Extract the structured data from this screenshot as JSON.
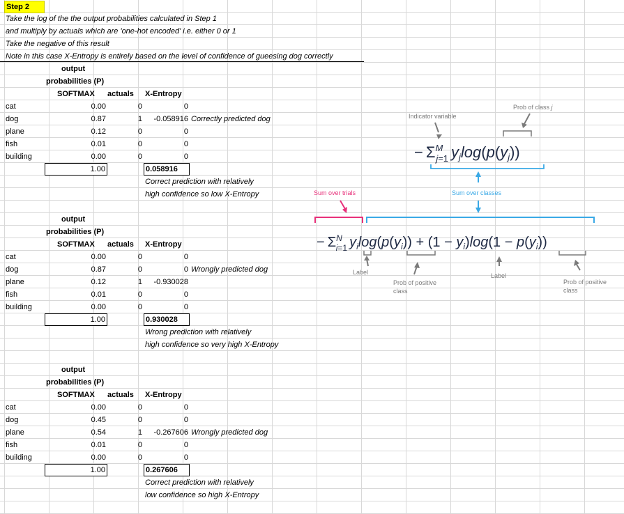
{
  "step": {
    "title": "Step 2",
    "lines": [
      "Take the log of the the output probabilities calculated in Step 1",
      "and multiply by actuals which are 'one-hot encoded' i.e. either 0 or 1",
      "Take the negative of this result",
      "Note in this case  X-Entropy  is entirely based on the level of confidence of gueesing dog correctly"
    ]
  },
  "headers": {
    "output": "output",
    "probabilities": "probabilities (P)",
    "softmax": "SOFTMAX",
    "actuals": "actuals",
    "xentropy": "X-Entropy"
  },
  "blocks": [
    {
      "rows": [
        {
          "label": "cat",
          "softmax": "0.00",
          "actual": "0",
          "xent": "0",
          "note": ""
        },
        {
          "label": "dog",
          "softmax": "0.87",
          "actual": "1",
          "xent": "-0.058916",
          "note": "Correctly predicted dog"
        },
        {
          "label": "plane",
          "softmax": "0.12",
          "actual": "0",
          "xent": "0",
          "note": ""
        },
        {
          "label": "fish",
          "softmax": "0.01",
          "actual": "0",
          "xent": "0",
          "note": ""
        },
        {
          "label": "building",
          "softmax": "0.00",
          "actual": "0",
          "xent": "0",
          "note": ""
        }
      ],
      "sum": "1.00",
      "total": "0.058916",
      "comment1": "Correct prediction with relatively",
      "comment2": "high confidence so low X-Entropy"
    },
    {
      "rows": [
        {
          "label": "cat",
          "softmax": "0.00",
          "actual": "0",
          "xent": "0",
          "note": ""
        },
        {
          "label": "dog",
          "softmax": "0.87",
          "actual": "0",
          "xent": "0",
          "note": "Wrongly predicted dog"
        },
        {
          "label": "plane",
          "softmax": "0.12",
          "actual": "1",
          "xent": "-0.930028",
          "note": ""
        },
        {
          "label": "fish",
          "softmax": "0.01",
          "actual": "0",
          "xent": "0",
          "note": ""
        },
        {
          "label": "building",
          "softmax": "0.00",
          "actual": "0",
          "xent": "0",
          "note": ""
        }
      ],
      "sum": "1.00",
      "total": "0.930028",
      "comment1": "Wrong prediction with relatively",
      "comment2": "high confidence so very high X-Entropy"
    },
    {
      "rows": [
        {
          "label": "cat",
          "softmax": "0.00",
          "actual": "0",
          "xent": "0",
          "note": ""
        },
        {
          "label": "dog",
          "softmax": "0.45",
          "actual": "0",
          "xent": "0",
          "note": ""
        },
        {
          "label": "plane",
          "softmax": "0.54",
          "actual": "1",
          "xent": "-0.267606",
          "note": "Wrongly predicted dog"
        },
        {
          "label": "fish",
          "softmax": "0.01",
          "actual": "0",
          "xent": "0",
          "note": ""
        },
        {
          "label": "building",
          "softmax": "0.00",
          "actual": "0",
          "xent": "0",
          "note": ""
        }
      ],
      "sum": "1.00",
      "total": "0.267606",
      "comment1": "Correct prediction with relatively",
      "comment2": "low confidence so high X-Entropy"
    }
  ],
  "diagram": {
    "indicator_label": "Indicator variable",
    "prob_class_label": "Prob of class",
    "prob_class_j": "j",
    "sum_trials": "Sum over trials",
    "sum_classes": "Sum over classes",
    "label_a": "Label",
    "label_b": "Label",
    "prob_positive_a1": "Prob of positive",
    "prob_positive_a2": "class",
    "prob_positive_b1": "Prob of positive",
    "prob_positive_b2": "class",
    "colors": {
      "pink": "#e8307a",
      "blue": "#3aa9e6",
      "gray": "#7a7a7a",
      "formula": "#1f2a44"
    }
  }
}
